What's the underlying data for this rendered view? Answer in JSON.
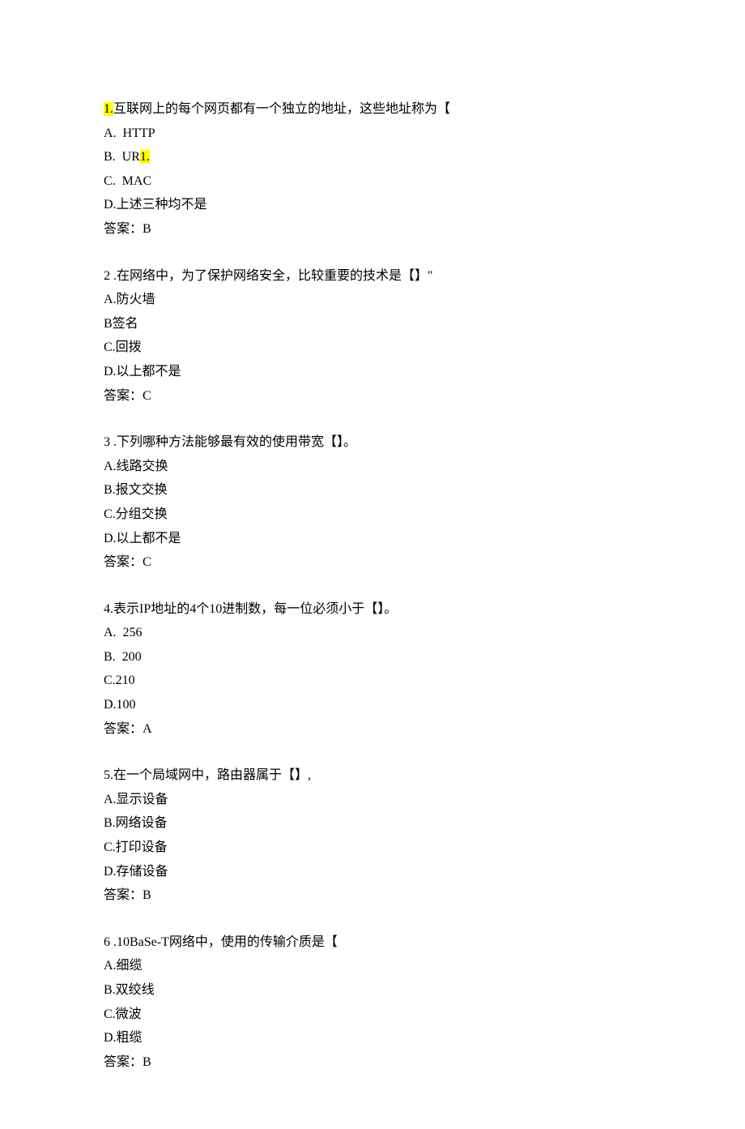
{
  "questions": [
    {
      "number_prefix": "1.",
      "number_highlight": true,
      "stem_plain": "互联网上的每个网页都有一个独立的地址，这些地址称为【",
      "options": [
        {
          "text": "A.  HTTP"
        },
        {
          "text_pre": "B.  UR",
          "text_hl": "1.",
          "text_post": ""
        },
        {
          "text": "C.  MAC"
        },
        {
          "text": "D.上述三种均不是"
        }
      ],
      "answer": "答案：B"
    },
    {
      "number_prefix": "2 .",
      "stem_plain": "在网络中，为了保护网络安全，比较重要的技术是【】\"",
      "options": [
        {
          "text": "A.防火墙"
        },
        {
          "text": "B签名"
        },
        {
          "text": "C.回拨"
        },
        {
          "text": "D.以上都不是"
        }
      ],
      "answer": "答案：C"
    },
    {
      "number_prefix": "3 .",
      "stem_plain": "下列哪种方法能够最有效的使用带宽【】。",
      "options": [
        {
          "text": "A.线路交换"
        },
        {
          "text": "B.报文交换"
        },
        {
          "text": "C.分组交换"
        },
        {
          "text": "D.以上都不是"
        }
      ],
      "answer": "答案：C"
    },
    {
      "number_prefix": "4.",
      "stem_plain": "表示IP地址的4个10进制数，每一位必须小于【】。",
      "options": [
        {
          "text": "A.  256"
        },
        {
          "text": "B.  200"
        },
        {
          "text": "C.210"
        },
        {
          "text": "D.100"
        }
      ],
      "answer": "答案：A"
    },
    {
      "number_prefix": "5.",
      "stem_plain": "在一个局域网中，路由器属于【】,",
      "options": [
        {
          "text": "A.显示设备"
        },
        {
          "text": "B.网络设备"
        },
        {
          "text": "C.打印设备"
        },
        {
          "text": "D.存储设备"
        }
      ],
      "answer": "答案：B"
    },
    {
      "number_prefix": "6 .",
      "stem_plain": "10BaSe-T网络中，使用的传输介质是【",
      "options": [
        {
          "text": "A.细缆"
        },
        {
          "text": "B.双绞线"
        },
        {
          "text": "C.微波"
        },
        {
          "text": "D.粗缆"
        }
      ],
      "answer": "答案：B"
    }
  ]
}
